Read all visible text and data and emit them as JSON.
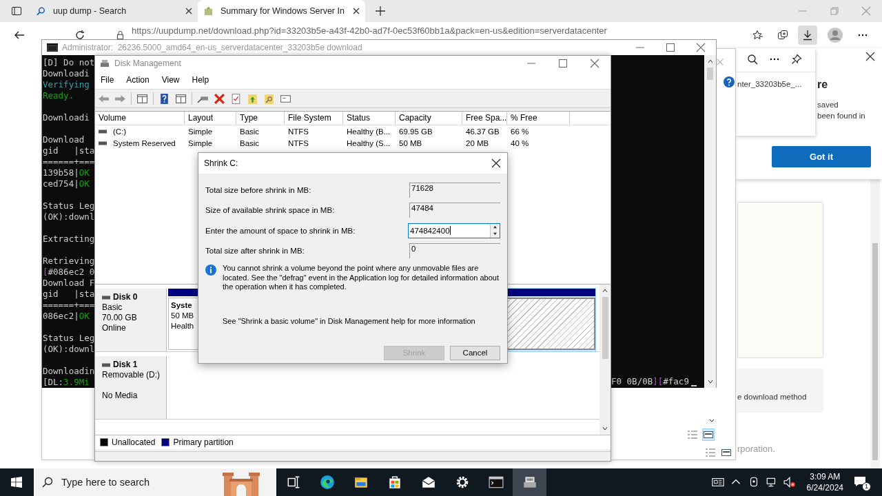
{
  "browser": {
    "tabs": [
      {
        "title": "uup dump - Search",
        "kind": "search",
        "selected": false
      },
      {
        "title": "Summary for Windows Server In",
        "kind": "site",
        "selected": true
      }
    ],
    "url": "https://uupdump.net/download.php?id=33203b5e-a43f-42b0-ad7f-0ec53f60bb1a&pack=en-us&edition=serverdatacenter",
    "downloads_open": true,
    "download_flyout": {
      "file": "nter_33203b5e_..."
    },
    "notice": {
      "heading": "re",
      "lines": [
        "saved",
        "been found in"
      ],
      "button": "Got it"
    },
    "page": {
      "method_text": "e download method",
      "footer": "rporation."
    }
  },
  "console": {
    "title": "Administrator:  26236.5000_amd64_en-us_serverdatacenter_33203b5e download",
    "blocks": [
      [
        [
          {
            "text": "[D] Do not",
            "color": "#cccccc"
          }
        ],
        [
          {
            "text": "Downloadi",
            "color": "#cccccc"
          }
        ],
        [
          {
            "text": "Verifying",
            "color": "#3a9ea5"
          }
        ],
        [
          {
            "text": "Ready.",
            "color": "#16a314"
          }
        ]
      ],
      [
        [
          {
            "text": "Downloadi",
            "color": "#cccccc"
          }
        ]
      ],
      [
        [
          {
            "text": "Download",
            "color": "#cccccc"
          }
        ],
        [
          {
            "text": "gid   |sta",
            "color": "#cccccc"
          }
        ],
        [
          {
            "text": "======+===",
            "color": "#cccccc"
          }
        ],
        [
          {
            "text": "139b58|",
            "color": "#cccccc"
          },
          {
            "text": "OK",
            "color": "#16a314"
          }
        ],
        [
          {
            "text": "ced754|",
            "color": "#cccccc"
          },
          {
            "text": "OK",
            "color": "#16a314"
          }
        ]
      ],
      [
        [
          {
            "text": "Status Leg",
            "color": "#cccccc"
          }
        ],
        [
          {
            "text": "(OK):downl",
            "color": "#cccccc"
          }
        ]
      ],
      [
        [
          {
            "text": "Extracting",
            "color": "#cccccc"
          }
        ]
      ],
      [
        [
          {
            "text": "Retrieving",
            "color": "#cccccc"
          }
        ],
        [
          {
            "text": "[",
            "color": "#b148c6"
          },
          {
            "text": "#086ec2 0",
            "color": "#cccccc"
          }
        ],
        [
          {
            "text": "Download F",
            "color": "#cccccc"
          }
        ],
        [
          {
            "text": "gid   |sta",
            "color": "#cccccc"
          }
        ],
        [
          {
            "text": "======+===",
            "color": "#cccccc"
          }
        ],
        [
          {
            "text": "086ec2|",
            "color": "#cccccc"
          },
          {
            "text": "OK",
            "color": "#16a314"
          }
        ]
      ],
      [
        [
          {
            "text": "Status Leg",
            "color": "#cccccc"
          }
        ],
        [
          {
            "text": "(OK):downl",
            "color": "#cccccc"
          }
        ]
      ],
      [
        [
          {
            "text": "Downloadin",
            "color": "#cccccc"
          }
        ],
        [
          {
            "text": "[DL:"
          },
          {
            "text": "3.9Mi",
            "color": "#16a314"
          }
        ]
      ]
    ],
    "tail": [
      {
        "text": "F0 0B/0B",
        "color": "#cccccc"
      },
      {
        "text": "][",
        "color": "#b148c6"
      },
      {
        "text": "#fac9",
        "color": "#cccccc"
      }
    ]
  },
  "disk_management": {
    "title": "Disk Management",
    "menu": [
      "File",
      "Action",
      "View",
      "Help"
    ],
    "columns": [
      "Volume",
      "Layout",
      "Type",
      "File System",
      "Status",
      "Capacity",
      "Free Spa...",
      "% Free"
    ],
    "volumes": [
      {
        "selected": false,
        "cells": [
          "(C:)",
          "Simple",
          "Basic",
          "NTFS",
          "Healthy (B...",
          "69.95 GB",
          "46.37 GB",
          "66 %"
        ]
      },
      {
        "selected": false,
        "cells": [
          "System Reserved",
          "Simple",
          "Basic",
          "NTFS",
          "Healthy (S...",
          "50 MB",
          "20 MB",
          "40 %"
        ]
      }
    ],
    "disks": [
      {
        "name": "Disk 0",
        "type": "Basic",
        "size": "70.00 GB",
        "status": "Online",
        "partitions": [
          {
            "selected": false,
            "name": "Syste",
            "size": "50 MB",
            "status": "Health"
          },
          {
            "selected": true
          }
        ]
      },
      {
        "name": "Disk 1",
        "type": "Removable (D:)",
        "status": "No Media"
      }
    ],
    "legend": [
      {
        "label": "Unallocated",
        "color": "#000000"
      },
      {
        "label": "Primary partition",
        "color": "#000080"
      }
    ]
  },
  "dialog": {
    "title": "Shrink C:",
    "fields": [
      {
        "label": "Total size before shrink in MB:",
        "value": "71628",
        "kind": "readonly"
      },
      {
        "label": "Size of available shrink space in MB:",
        "value": "47484",
        "kind": "readonly"
      },
      {
        "label": "Enter the amount of space to shrink in MB:",
        "value": "474842400",
        "kind": "spin"
      },
      {
        "label": "Total size after shrink in MB:",
        "value": "0",
        "kind": "readonly"
      }
    ],
    "info": "You cannot shrink a volume beyond the point where any unmovable files are located. See the \"defrag\" event in the Application log for detailed information about the operation when it has completed.",
    "help": "See \"Shrink a basic volume\" in Disk Management help for more information",
    "buttons": [
      {
        "label": "Shrink",
        "disabled": true
      },
      {
        "label": "Cancel",
        "disabled": false
      }
    ]
  },
  "taskbar": {
    "search_placeholder": "Type here to search",
    "apps": [
      {
        "kind": "taskview",
        "active": false
      },
      {
        "kind": "edge",
        "active": false
      },
      {
        "kind": "explorer",
        "active": false
      },
      {
        "kind": "store",
        "active": false
      },
      {
        "kind": "mail",
        "active": false
      },
      {
        "kind": "settings",
        "active": false
      },
      {
        "kind": "terminal",
        "active": false
      },
      {
        "kind": "diskmgmt",
        "active": true
      }
    ],
    "time": "3:09 AM",
    "date": "6/24/2024",
    "notifications": "1"
  }
}
